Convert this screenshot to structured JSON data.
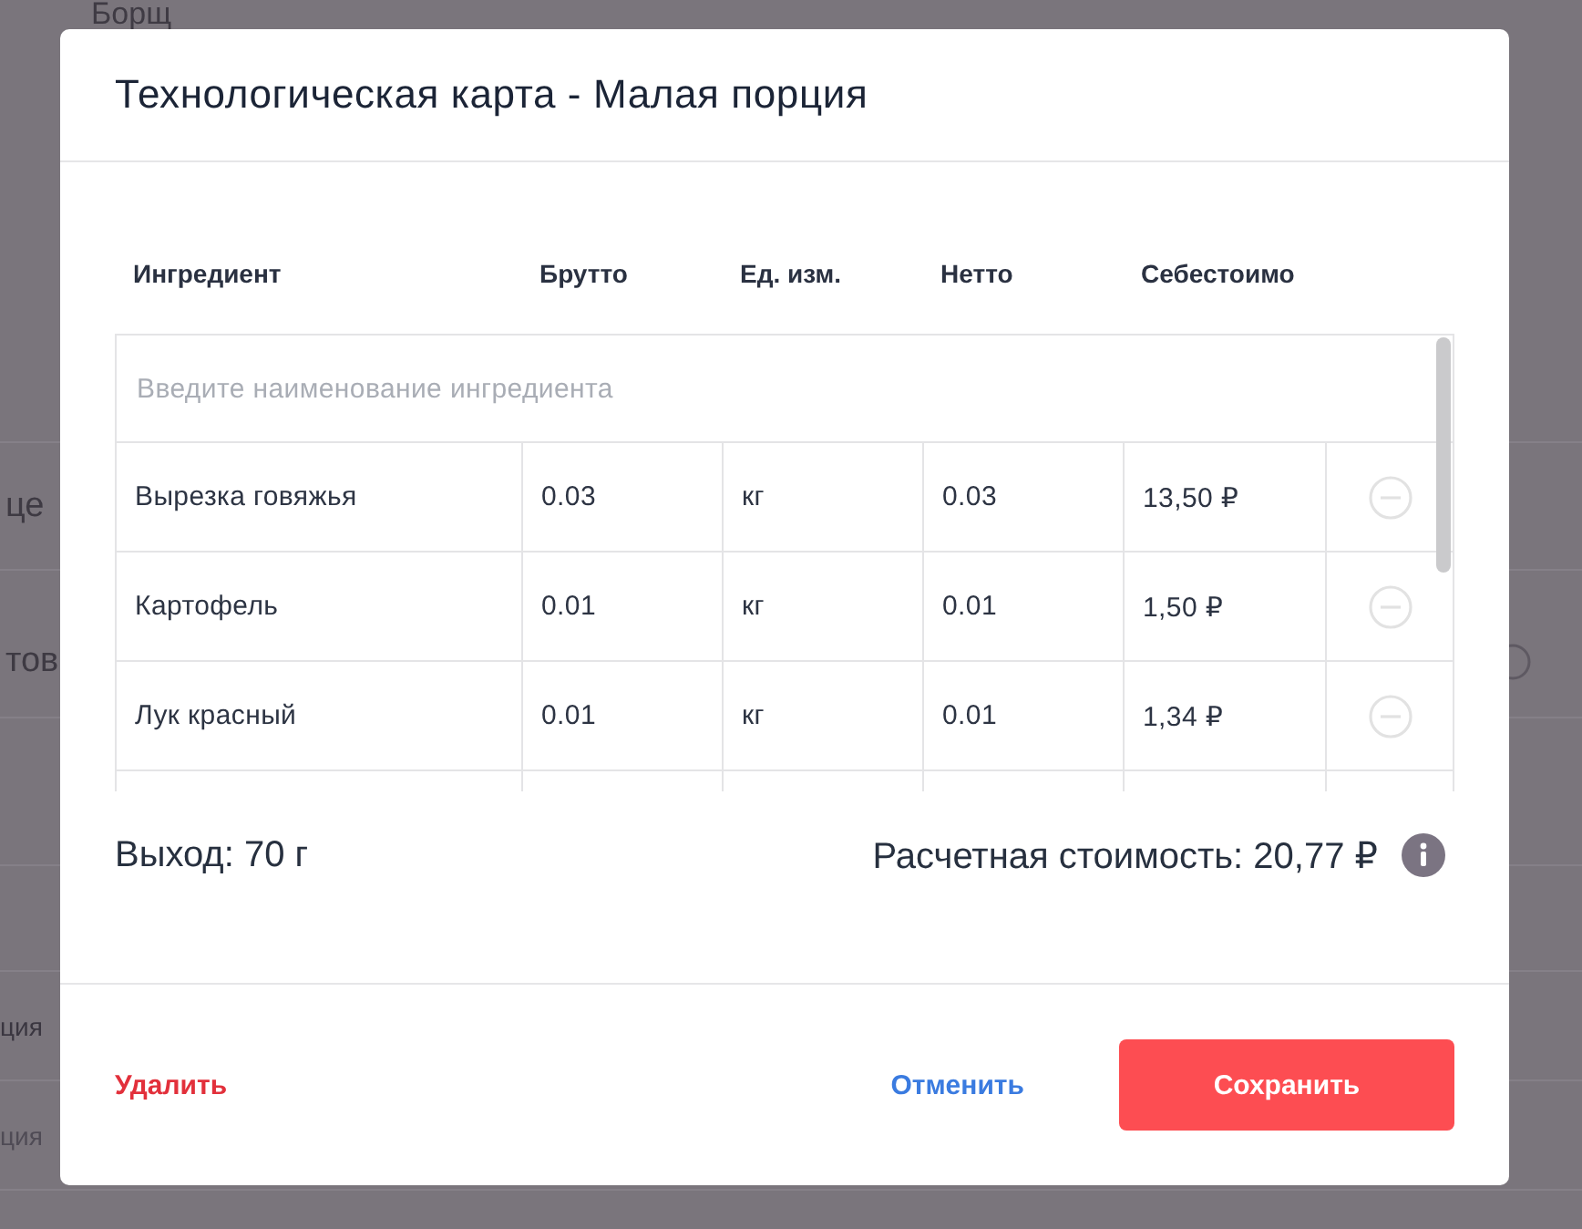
{
  "background": {
    "title": "Борщ",
    "sections": [
      {
        "label": "це",
        "toggle": false
      },
      {
        "label": "тов",
        "toggle": true
      }
    ],
    "items": [
      {
        "label": "ция",
        "disabled": false
      },
      {
        "label": "ция",
        "disabled": true
      }
    ]
  },
  "dialog": {
    "title": "Технологическая карта - Малая порция",
    "columns": [
      "Ингредиент",
      "Брутто",
      "Ед. изм.",
      "Нетто",
      "Себестоимо"
    ],
    "search": {
      "placeholder": "Введите наименование ингредиента"
    },
    "rows": [
      {
        "cells": [
          "Вырезка говяжья",
          "0.03",
          "кг",
          "0.03",
          "13,50 ₽"
        ]
      },
      {
        "cells": [
          "Картофель",
          "0.01",
          "кг",
          "0.01",
          "1,50 ₽"
        ]
      },
      {
        "cells": [
          "Лук красный",
          "0.01",
          "кг",
          "0.01",
          "1,34 ₽"
        ]
      }
    ],
    "yield": "Выход: 70 г",
    "estimated_cost": "Расчетная стоимость: 20,77 ₽",
    "buttons": [
      {
        "kind": "danger-link",
        "label": "Удалить"
      },
      {
        "kind": "link",
        "label": "Отменить"
      },
      {
        "kind": "primary",
        "label": "Сохранить"
      }
    ]
  }
}
